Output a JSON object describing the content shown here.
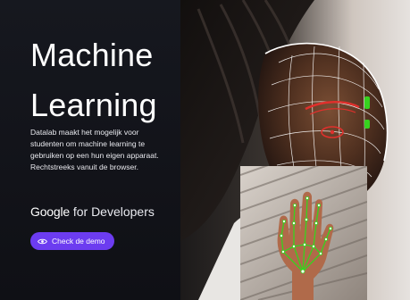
{
  "hero": {
    "title_line1": "Machine",
    "title_line2": "Learning",
    "description": "Datalab maakt het mogelijk voor studenten om machine learning te gebruiken op een hun eigen apparaat. Rechtstreeks vanuit de browser.",
    "brand": {
      "google": "Google",
      "rest": "for Developers"
    },
    "demo_button": {
      "label": "Check de demo",
      "icon": "eye-icon"
    }
  },
  "colors": {
    "panel_bg": "#14161c",
    "button_bg": "#6c3cf0",
    "face_mesh": "#ffffff",
    "eye_marker": "#e0302c",
    "tracking_green": "#37d21f"
  }
}
